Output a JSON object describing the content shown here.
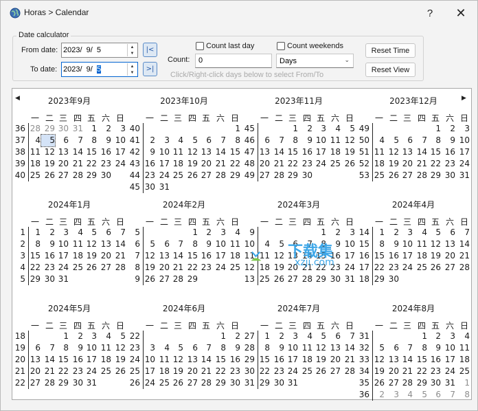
{
  "window": {
    "title": "Horas > Calendar",
    "help_label": "?",
    "close_label": "✕",
    "icon": "globe-icon"
  },
  "calc": {
    "group_label": "Date calculator",
    "from_label": "From date:",
    "from_value": "2023/  9/  5",
    "to_label": "To date:",
    "to_value_prefix": "2023/  9/  ",
    "to_value_selected": "5",
    "jump_from_label": "|<",
    "jump_to_label": ">|",
    "count_last_day": "Count last day",
    "count_weekends": "Count weekends",
    "count_label": "Count:",
    "count_value": "0",
    "unit_value": "Days",
    "hint": "Click/Right-click days below to select From/To",
    "reset_time": "Reset Time",
    "reset_view": "Reset View"
  },
  "nav": {
    "prev": "◀",
    "next": "▶"
  },
  "weekday_headers": [
    "一",
    "二",
    "三",
    "四",
    "五",
    "六",
    "日"
  ],
  "months": [
    {
      "title": "2023年9月",
      "rows": [
        {
          "wk": "36",
          "days": [
            "28",
            "29",
            "30",
            "31",
            "1",
            "2",
            "3"
          ],
          "other": [
            0,
            1,
            2,
            3
          ]
        },
        {
          "wk": "37",
          "days": [
            "4",
            "5",
            "6",
            "7",
            "8",
            "9",
            "10"
          ],
          "sel": 1
        },
        {
          "wk": "38",
          "days": [
            "11",
            "12",
            "13",
            "14",
            "15",
            "16",
            "17"
          ]
        },
        {
          "wk": "39",
          "days": [
            "18",
            "19",
            "20",
            "21",
            "22",
            "23",
            "24"
          ]
        },
        {
          "wk": "40",
          "days": [
            "25",
            "26",
            "27",
            "28",
            "29",
            "30",
            ""
          ]
        }
      ]
    },
    {
      "title": "2023年10月",
      "rows": [
        {
          "wk": "40",
          "days": [
            "",
            "",
            "",
            "",
            "",
            "",
            "1"
          ]
        },
        {
          "wk": "41",
          "days": [
            "2",
            "3",
            "4",
            "5",
            "6",
            "7",
            "8"
          ]
        },
        {
          "wk": "42",
          "days": [
            "9",
            "10",
            "11",
            "12",
            "13",
            "14",
            "15"
          ]
        },
        {
          "wk": "43",
          "days": [
            "16",
            "17",
            "18",
            "19",
            "20",
            "21",
            "22"
          ]
        },
        {
          "wk": "44",
          "days": [
            "23",
            "24",
            "25",
            "26",
            "27",
            "28",
            "29"
          ]
        },
        {
          "wk": "45",
          "days": [
            "30",
            "31",
            "",
            "",
            "",
            "",
            ""
          ]
        }
      ]
    },
    {
      "title": "2023年11月",
      "rows": [
        {
          "wk": "45",
          "days": [
            "",
            "",
            "1",
            "2",
            "3",
            "4",
            "5"
          ]
        },
        {
          "wk": "46",
          "days": [
            "6",
            "7",
            "8",
            "9",
            "10",
            "11",
            "12"
          ]
        },
        {
          "wk": "47",
          "days": [
            "13",
            "14",
            "15",
            "16",
            "17",
            "18",
            "19"
          ]
        },
        {
          "wk": "48",
          "days": [
            "20",
            "21",
            "22",
            "23",
            "24",
            "25",
            "26"
          ]
        },
        {
          "wk": "49",
          "days": [
            "27",
            "28",
            "29",
            "30",
            "",
            "",
            ""
          ]
        }
      ]
    },
    {
      "title": "2023年12月",
      "rows": [
        {
          "wk": "49",
          "days": [
            "",
            "",
            "",
            "",
            "1",
            "2",
            "3"
          ]
        },
        {
          "wk": "50",
          "days": [
            "4",
            "5",
            "6",
            "7",
            "8",
            "9",
            "10"
          ]
        },
        {
          "wk": "51",
          "days": [
            "11",
            "12",
            "13",
            "14",
            "15",
            "16",
            "17"
          ]
        },
        {
          "wk": "52",
          "days": [
            "18",
            "19",
            "20",
            "21",
            "22",
            "23",
            "24"
          ]
        },
        {
          "wk": "53",
          "days": [
            "25",
            "26",
            "27",
            "28",
            "29",
            "30",
            "31"
          ]
        }
      ]
    },
    {
      "title": "2024年1月",
      "rows": [
        {
          "wk": "1",
          "days": [
            "1",
            "2",
            "3",
            "4",
            "5",
            "6",
            "7"
          ]
        },
        {
          "wk": "2",
          "days": [
            "8",
            "9",
            "10",
            "11",
            "12",
            "13",
            "14"
          ]
        },
        {
          "wk": "3",
          "days": [
            "15",
            "16",
            "17",
            "18",
            "19",
            "20",
            "21"
          ]
        },
        {
          "wk": "4",
          "days": [
            "22",
            "23",
            "24",
            "25",
            "26",
            "27",
            "28"
          ]
        },
        {
          "wk": "5",
          "days": [
            "29",
            "30",
            "31",
            "",
            "",
            "",
            ""
          ]
        }
      ]
    },
    {
      "title": "2024年2月",
      "rows": [
        {
          "wk": "5",
          "days": [
            "",
            "",
            "",
            "1",
            "2",
            "3",
            "4"
          ]
        },
        {
          "wk": "6",
          "days": [
            "5",
            "6",
            "7",
            "8",
            "9",
            "10",
            "11"
          ]
        },
        {
          "wk": "7",
          "days": [
            "12",
            "13",
            "14",
            "15",
            "16",
            "17",
            "18"
          ]
        },
        {
          "wk": "8",
          "days": [
            "19",
            "20",
            "21",
            "22",
            "23",
            "24",
            "25"
          ]
        },
        {
          "wk": "9",
          "days": [
            "26",
            "27",
            "28",
            "29",
            "",
            "",
            ""
          ]
        }
      ]
    },
    {
      "title": "2024年3月",
      "rows": [
        {
          "wk": "9",
          "days": [
            "",
            "",
            "",
            "",
            "1",
            "2",
            "3"
          ]
        },
        {
          "wk": "10",
          "days": [
            "4",
            "5",
            "6",
            "7",
            "8",
            "9",
            "10"
          ]
        },
        {
          "wk": "11",
          "days": [
            "11",
            "12",
            "13",
            "14",
            "15",
            "16",
            "17"
          ]
        },
        {
          "wk": "12",
          "days": [
            "18",
            "19",
            "20",
            "21",
            "22",
            "23",
            "24"
          ]
        },
        {
          "wk": "13",
          "days": [
            "25",
            "26",
            "27",
            "28",
            "29",
            "30",
            "31"
          ]
        }
      ]
    },
    {
      "title": "2024年4月",
      "rows": [
        {
          "wk": "14",
          "days": [
            "1",
            "2",
            "3",
            "4",
            "5",
            "6",
            "7"
          ]
        },
        {
          "wk": "15",
          "days": [
            "8",
            "9",
            "10",
            "11",
            "12",
            "13",
            "14"
          ]
        },
        {
          "wk": "16",
          "days": [
            "15",
            "16",
            "17",
            "18",
            "19",
            "20",
            "21"
          ]
        },
        {
          "wk": "17",
          "days": [
            "22",
            "23",
            "24",
            "25",
            "26",
            "27",
            "28"
          ]
        },
        {
          "wk": "18",
          "days": [
            "29",
            "30",
            "",
            "",
            "",
            "",
            ""
          ]
        }
      ]
    },
    {
      "title": "2024年5月",
      "rows": [
        {
          "wk": "18",
          "days": [
            "",
            "",
            "1",
            "2",
            "3",
            "4",
            "5"
          ]
        },
        {
          "wk": "19",
          "days": [
            "6",
            "7",
            "8",
            "9",
            "10",
            "11",
            "12"
          ]
        },
        {
          "wk": "20",
          "days": [
            "13",
            "14",
            "15",
            "16",
            "17",
            "18",
            "19"
          ]
        },
        {
          "wk": "21",
          "days": [
            "20",
            "21",
            "22",
            "23",
            "24",
            "25",
            "26"
          ]
        },
        {
          "wk": "22",
          "days": [
            "27",
            "28",
            "29",
            "30",
            "31",
            "",
            ""
          ]
        }
      ]
    },
    {
      "title": "2024年6月",
      "rows": [
        {
          "wk": "22",
          "days": [
            "",
            "",
            "",
            "",
            "",
            "1",
            "2"
          ]
        },
        {
          "wk": "23",
          "days": [
            "3",
            "4",
            "5",
            "6",
            "7",
            "8",
            "9"
          ]
        },
        {
          "wk": "24",
          "days": [
            "10",
            "11",
            "12",
            "13",
            "14",
            "15",
            "16"
          ]
        },
        {
          "wk": "25",
          "days": [
            "17",
            "18",
            "19",
            "20",
            "21",
            "22",
            "23"
          ]
        },
        {
          "wk": "26",
          "days": [
            "24",
            "25",
            "26",
            "27",
            "28",
            "29",
            "30"
          ]
        }
      ]
    },
    {
      "title": "2024年7月",
      "rows": [
        {
          "wk": "27",
          "days": [
            "1",
            "2",
            "3",
            "4",
            "5",
            "6",
            "7"
          ]
        },
        {
          "wk": "28",
          "days": [
            "8",
            "9",
            "10",
            "11",
            "12",
            "13",
            "14"
          ]
        },
        {
          "wk": "29",
          "days": [
            "15",
            "16",
            "17",
            "18",
            "19",
            "20",
            "21"
          ]
        },
        {
          "wk": "30",
          "days": [
            "22",
            "23",
            "24",
            "25",
            "26",
            "27",
            "28"
          ]
        },
        {
          "wk": "31",
          "days": [
            "29",
            "30",
            "31",
            "",
            "",
            "",
            ""
          ]
        }
      ]
    },
    {
      "title": "2024年8月",
      "rows": [
        {
          "wk": "31",
          "days": [
            "",
            "",
            "",
            "1",
            "2",
            "3",
            "4"
          ]
        },
        {
          "wk": "32",
          "days": [
            "5",
            "6",
            "7",
            "8",
            "9",
            "10",
            "11"
          ]
        },
        {
          "wk": "33",
          "days": [
            "12",
            "13",
            "14",
            "15",
            "16",
            "17",
            "18"
          ]
        },
        {
          "wk": "34",
          "days": [
            "19",
            "20",
            "21",
            "22",
            "23",
            "24",
            "25"
          ]
        },
        {
          "wk": "35",
          "days": [
            "26",
            "27",
            "28",
            "29",
            "30",
            "31",
            "1"
          ],
          "other": [
            6
          ]
        },
        {
          "wk": "36",
          "days": [
            "2",
            "3",
            "4",
            "5",
            "6",
            "7",
            "8"
          ],
          "other": [
            0,
            1,
            2,
            3,
            4,
            5,
            6
          ]
        }
      ]
    }
  ],
  "watermark": {
    "text": "下载集",
    "sub": "xzji.com"
  }
}
